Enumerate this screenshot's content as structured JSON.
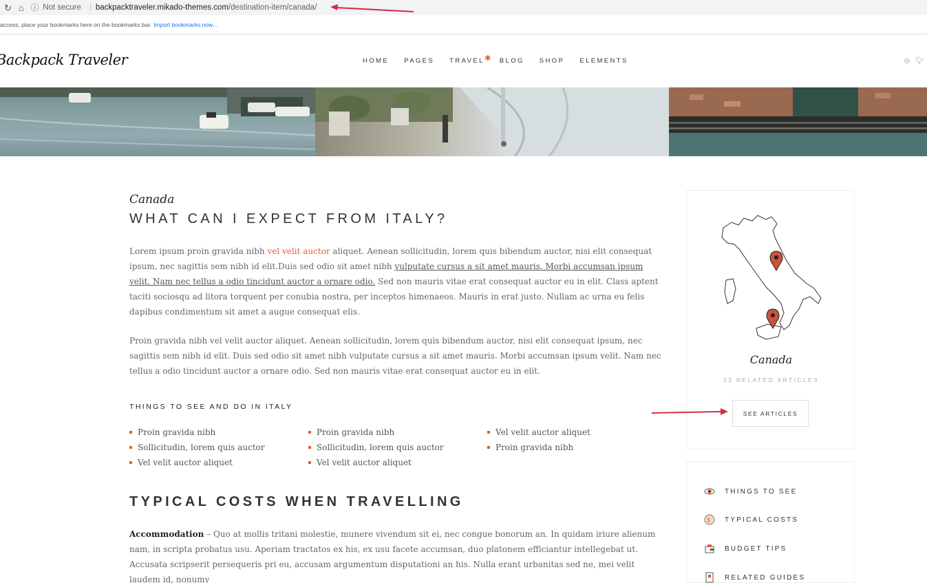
{
  "browser": {
    "security": "Not secure",
    "url_host": "backpacktraveler.mikado-themes.com",
    "url_path": "/destination-item/canada/",
    "bookmarks_text": "access, place your bookmarks here on the bookmarks bar.",
    "bookmarks_link": "Import bookmarks now..."
  },
  "header": {
    "logo": "Backpack Traveler",
    "nav": [
      "HOME",
      "PAGES",
      "TRAVEL",
      "BLOG",
      "SHOP",
      "ELEMENTS"
    ]
  },
  "main": {
    "script_label": "Canada",
    "title": "WHAT CAN I EXPECT FROM ITALY?",
    "para1_a": "Lorem ipsum proin gravida nibh ",
    "para1_link": "vel velit auctor",
    "para1_b": " aliquet. Aenean sollicitudin, lorem quis bibendum auctor, nisi elit consequat ipsum, nec sagittis sem nibh id elit.Duis sed odio sit amet nibh ",
    "para1_under": "vulputate cursus a sit amet mauris. Morbi accumsan ipsum velit. Nam nec tellus a odio tincidunt auctor a ornare odio.",
    "para1_c": " Sed non mauris vitae erat consequat auctor eu in elit. Class aptent taciti sociosqu ad litora torquent per conubia nostra, per inceptos himenaeos. Mauris in erat justo. Nullam ac urna eu felis dapibus condimentum sit amet a augue consequat elis.",
    "para2": "Proin gravida nibh vel velit auctor aliquet. Aenean sollicitudin, lorem quis bibendum auctor, nisi elit consequat ipsum, nec sagittis sem nibh id elit. Duis sed odio sit amet nibh vulputate cursus a sit amet mauris. Morbi accumsan ipsum velit. Nam nec tellus a odio tincidunt auctor a ornare odio. Sed non mauris vitae erat consequat auctor eu in elit.",
    "things_title": "THINGS TO SEE AND DO IN ITALY",
    "list1": [
      "Proin gravida nibh",
      "Sollicitudin, lorem quis auctor",
      "Vel velit auctor aliquet"
    ],
    "list2": [
      "Proin gravida nibh",
      "Sollicitudin, lorem quis auctor",
      "Vel velit auctor aliquet"
    ],
    "list3": [
      "Vel velit auctor aliquet",
      "Proin gravida nibh"
    ],
    "costs_title": "TYPICAL COSTS WHEN TRAVELLING",
    "para3_bold": "Accommodation",
    "para3": " – Quo at mollis tritani molestie, munere vivendum sit ei, nec congue bonorum an. In quidam iriure alienum nam, in scripta probatus usu. Aperiam tractatos ex his, ex usu facete accumsan, duo platonem efficiantur intellegebat ut. Accusata scripserit persequeris pri eu, accusam argumentum disputationi an his. Nulla erant urbanitas sed ne, mei velit laudem id, nonumy"
  },
  "sidebar": {
    "script_label": "Canada",
    "related": "33 RELATED ARTICLES",
    "button": "SEE ARTICLES",
    "menu": [
      {
        "label": "THINGS TO SEE",
        "icon": "eye-icon"
      },
      {
        "label": "TYPICAL COSTS",
        "icon": "coin-icon"
      },
      {
        "label": "BUDGET TIPS",
        "icon": "wallet-icon"
      },
      {
        "label": "RELATED GUIDES",
        "icon": "guide-icon"
      }
    ]
  },
  "colors": {
    "accent": "#e05d35",
    "annotation_arrow": "#d62b4a"
  }
}
